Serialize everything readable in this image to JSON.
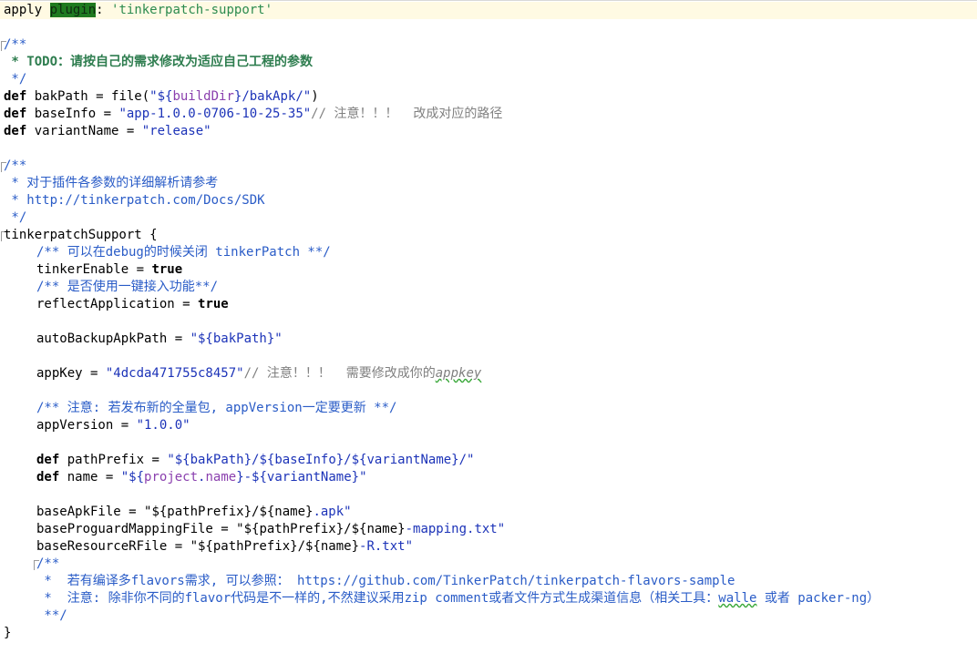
{
  "code": {
    "apply_kw": "apply",
    "plugin_word": "plugin",
    "apply_colon": ": ",
    "apply_value": "'tinkerpatch-support'",
    "doc1_open": "/**",
    "doc1_todo": " * TODO：请按自己的需求修改为适应自己工程的参数",
    "doc1_close": " */",
    "def": "def",
    "bak_name": " bakPath = file(",
    "bak_str_a": "\"${",
    "bak_builddir": "buildDir",
    "bak_str_b": "}/bakApk/\"",
    "bak_close": ")",
    "base_name": " baseInfo = ",
    "base_str": "\"app-1.0.0-0706-10-25-35\"",
    "base_comment": "// 注意！！！  改成对应的路径",
    "variant_name": " variantName = ",
    "variant_str": "\"release\"",
    "doc2_open": "/**",
    "doc2_line1": " * 对于插件各参数的详细解析请参考",
    "doc2_line2": " * http://tinkerpatch.com/Docs/SDK",
    "doc2_close": " */",
    "block_open": "tinkerpatchSupport {",
    "c_debug": "/** 可以在debug的时候关闭 tinkerPatch **/",
    "tinker_enable": "tinkerEnable = ",
    "true_kw": "true",
    "c_onekey": "/** 是否使用一键接入功能**/",
    "reflect_app": "reflectApplication = ",
    "auto_backup": "autoBackupApkPath = ",
    "auto_backup_str": "\"${bakPath}\"",
    "app_key": "appKey = ",
    "app_key_str": "\"4dcda471755c8457\"",
    "app_key_comment": "// 注意！！！  需要修改成你的",
    "app_key_comment_word": "appkey",
    "c_version": "/** 注意: 若发布新的全量包, appVersion一定要更新 **/",
    "app_version": "appVersion = ",
    "app_version_str": "\"1.0.0\"",
    "path_prefix_name": " pathPrefix = ",
    "path_prefix_str": "\"${bakPath}/${baseInfo}/${variantName}/\"",
    "name_name": " name = ",
    "name_str_a": "\"${",
    "name_project": "project",
    "name_dot": ".",
    "name_name_word": "name",
    "name_str_b": "}-${variantName}\"",
    "base_apk": "baseApkFile = ",
    "base_apk_str_a": "\"${pathPrefix}/${name}",
    "base_apk_str_b": ".apk\"",
    "base_mapping": "baseProguardMappingFile = ",
    "base_mapping_str_a": "\"${pathPrefix}/${name}",
    "base_mapping_str_b": "-mapping.txt\"",
    "base_res": "baseResourceRFile = ",
    "base_res_str_a": "\"${pathPrefix}/${name}",
    "base_res_str_b": "-R.txt\"",
    "doc3_open": "/**",
    "doc3_line1": " *  若有编译多flavors需求, 可以参照： https://github.com/TinkerPatch/tinkerpatch-flavors-sample",
    "doc3_line2_a": " *  注意: 除非你不同的flavor代码是不一样的,不然建议采用zip comment或者文件方式生成渠道信息（相关工具：",
    "doc3_walle": "walle",
    "doc3_line2_b": " 或者 packer-ng）",
    "doc3_close": " **/",
    "block_close": "}"
  },
  "colors": {
    "keyword": "#000080",
    "string": "#1c33b8",
    "comment": "#2a5cc7",
    "grey_comment": "#808080",
    "todo": "#2e7d4f",
    "interpolation": "#8a3fae",
    "plugin_highlight": "#1f7a1f",
    "current_line": "#fffae3"
  }
}
